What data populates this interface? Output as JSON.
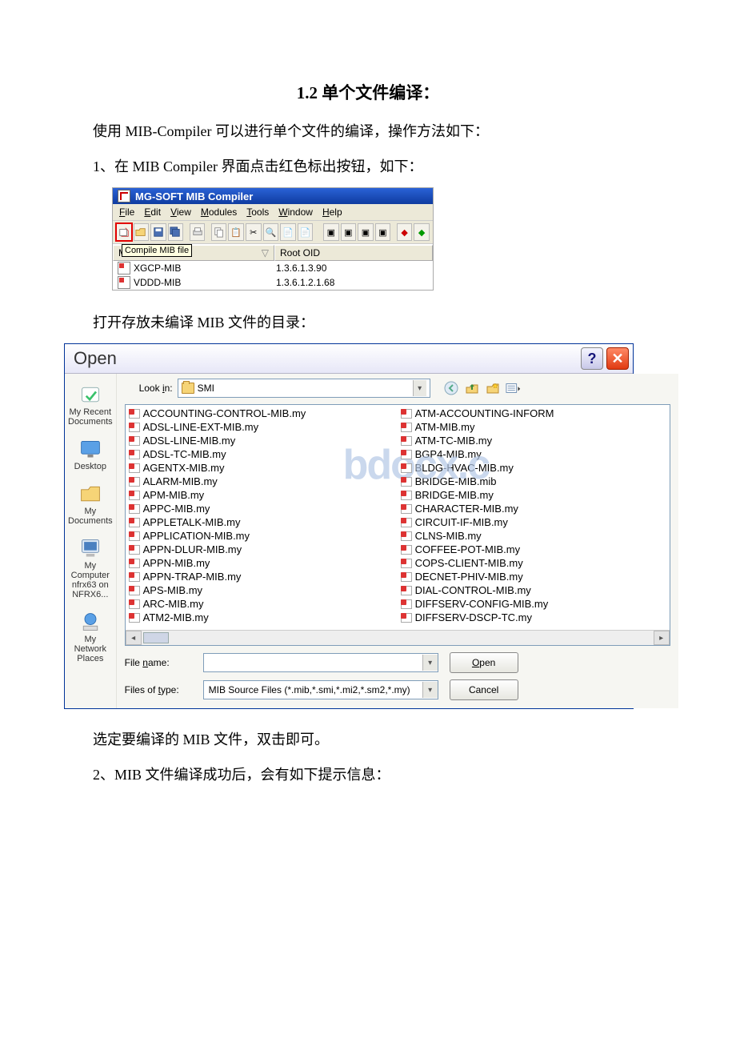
{
  "doc": {
    "heading": "1.2 单个文件编译：",
    "p1": "使用 MIB-Compiler 可以进行单个文件的编译，操作方法如下：",
    "p2": "1、在 MIB Compiler 界面点击红色标出按钮，如下：",
    "p3": "打开存放未编译 MIB 文件的目录：",
    "p4": "选定要编译的 MIB 文件，双击即可。",
    "p5": "2、MIB 文件编译成功后，会有如下提示信息："
  },
  "shot1": {
    "title": "MG-SOFT MIB Compiler",
    "menu": [
      "File",
      "Edit",
      "View",
      "Modules",
      "Tools",
      "Window",
      "Help"
    ],
    "tooltip": "Compile MIB file",
    "header_left": "Module",
    "header_right": "Root OID",
    "rows": [
      {
        "name": "XGCP-MIB",
        "oid": "1.3.6.1.3.90"
      },
      {
        "name": "VDDD-MIB",
        "oid": "1.3.6.1.2.1.68"
      }
    ]
  },
  "shot2": {
    "title": "Open",
    "lookin_label": "Look in:",
    "lookin_value": "SMI",
    "places": [
      "My Recent Documents",
      "Desktop",
      "My Documents",
      "My Computer",
      "nfrx63 on NFRX6...",
      "My Network Places"
    ],
    "filesA": [
      "ACCOUNTING-CONTROL-MIB.my",
      "ADSL-LINE-EXT-MIB.my",
      "ADSL-LINE-MIB.my",
      "ADSL-TC-MIB.my",
      "AGENTX-MIB.my",
      "ALARM-MIB.my",
      "APM-MIB.my",
      "APPC-MIB.my",
      "APPLETALK-MIB.my",
      "APPLICATION-MIB.my",
      "APPN-DLUR-MIB.my",
      "APPN-MIB.my",
      "APPN-TRAP-MIB.my",
      "APS-MIB.my",
      "ARC-MIB.my",
      "ATM2-MIB.my"
    ],
    "filesB": [
      "ATM-ACCOUNTING-INFORM",
      "ATM-MIB.my",
      "ATM-TC-MIB.my",
      "BGP4-MIB.my",
      "BLDG-HVAC-MIB.my",
      "BRIDGE-MIB.mib",
      "BRIDGE-MIB.my",
      "CHARACTER-MIB.my",
      "CIRCUIT-IF-MIB.my",
      "CLNS-MIB.my",
      "COFFEE-POT-MIB.my",
      "COPS-CLIENT-MIB.my",
      "DECNET-PHIV-MIB.my",
      "DIAL-CONTROL-MIB.my",
      "DIFFSERV-CONFIG-MIB.my",
      "DIFFSERV-DSCP-TC.my"
    ],
    "filename_label": "File name:",
    "filename_value": "",
    "filetype_label": "Files of type:",
    "filetype_value": "MIB Source Files (*.mib,*.smi,*.mi2,*.sm2,*.my)",
    "btn_open": "Open",
    "btn_cancel": "Cancel",
    "watermark": "bdocx.c"
  }
}
